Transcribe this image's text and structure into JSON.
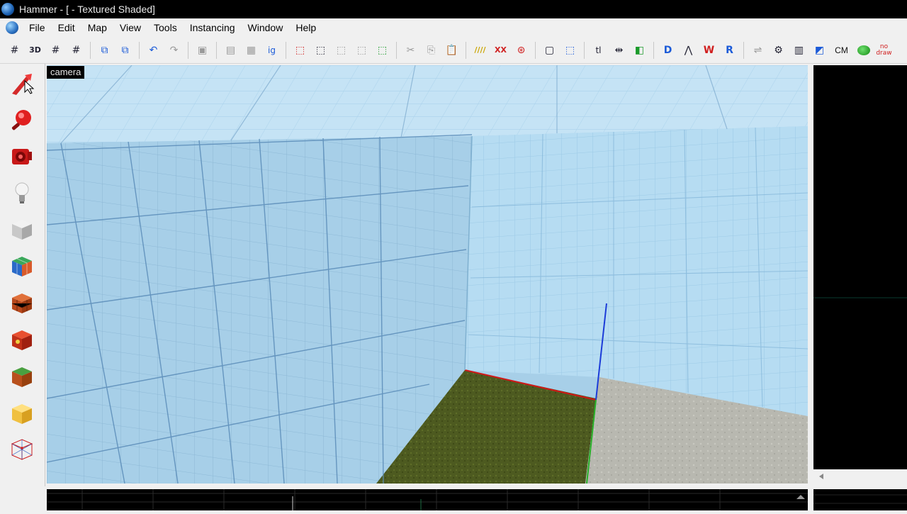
{
  "window": {
    "title": "Hammer - [ - Textured Shaded]"
  },
  "menu": {
    "items": [
      "File",
      "Edit",
      "Map",
      "View",
      "Tools",
      "Instancing",
      "Window",
      "Help"
    ]
  },
  "toolbar": {
    "buttons": [
      {
        "icon": "grid-icon",
        "glyph": "#"
      },
      {
        "icon": "3d-grid-icon",
        "glyph": "3D"
      },
      {
        "icon": "smaller-grid-icon",
        "glyph": "#"
      },
      {
        "icon": "larger-grid-icon",
        "glyph": "#"
      },
      {
        "icon": "group-icon",
        "glyph": "⧉"
      },
      {
        "icon": "ungroup-icon",
        "glyph": "⧉"
      },
      {
        "icon": "undo-icon",
        "glyph": "↶"
      },
      {
        "icon": "redo-icon",
        "glyph": "↷"
      },
      {
        "icon": "carve-icon",
        "glyph": "▣"
      },
      {
        "icon": "hollow-icon",
        "glyph": "▤"
      },
      {
        "icon": "texture-lock-icon",
        "glyph": "▦"
      },
      {
        "icon": "ignore-grouping-icon",
        "glyph": "ig"
      },
      {
        "icon": "selection-box-icon",
        "glyph": "⬚"
      },
      {
        "icon": "select-icon",
        "glyph": "⬚"
      },
      {
        "icon": "copy-icon",
        "glyph": "⬚"
      },
      {
        "icon": "paste-icon",
        "glyph": "⬚"
      },
      {
        "icon": "paste-special-icon",
        "glyph": "⬚"
      },
      {
        "icon": "cut-icon",
        "glyph": "✂"
      },
      {
        "icon": "copy-clip-icon",
        "glyph": "⎘"
      },
      {
        "icon": "paste-clip-icon",
        "glyph": "📋"
      },
      {
        "icon": "hazard-icon",
        "glyph": "////"
      },
      {
        "icon": "hazard-x-icon",
        "glyph": "XX"
      },
      {
        "icon": "run-map-icon",
        "glyph": "⊛"
      },
      {
        "icon": "to-world-icon",
        "glyph": "▢"
      },
      {
        "icon": "to-entity-icon",
        "glyph": "⬚"
      },
      {
        "icon": "align-icon",
        "glyph": "tl"
      },
      {
        "icon": "move-icon",
        "glyph": "⇹"
      },
      {
        "icon": "flip-icon",
        "glyph": "◧"
      },
      {
        "icon": "display-d-icon",
        "glyph": "D"
      },
      {
        "icon": "display-path-icon",
        "glyph": "⋀"
      },
      {
        "icon": "display-w-icon",
        "glyph": "W"
      },
      {
        "icon": "display-r-icon",
        "glyph": "R"
      },
      {
        "icon": "sliders-icon",
        "glyph": "⇌"
      },
      {
        "icon": "gear-icon",
        "glyph": "⚙"
      },
      {
        "icon": "overlay-icon",
        "glyph": "▥"
      },
      {
        "icon": "cubes-icon",
        "glyph": "◩"
      }
    ],
    "cm_label": "CM",
    "nodraw_label_top": "no",
    "nodraw_label_bottom": "draw"
  },
  "tools": [
    {
      "name": "selection-tool",
      "icon": "arrow-pointer-icon"
    },
    {
      "name": "magnify-tool",
      "icon": "magnifier-icon"
    },
    {
      "name": "camera-tool",
      "icon": "camera-icon"
    },
    {
      "name": "entity-tool",
      "icon": "lightbulb-icon"
    },
    {
      "name": "block-tool",
      "icon": "block-icon"
    },
    {
      "name": "texture-application-tool",
      "icon": "texture-cube-icon"
    },
    {
      "name": "apply-current-texture-tool",
      "icon": "apply-texture-icon"
    },
    {
      "name": "decal-tool",
      "icon": "decal-icon"
    },
    {
      "name": "overlay-tool",
      "icon": "overlay-cube-icon"
    },
    {
      "name": "clipping-tool",
      "icon": "clip-icon"
    },
    {
      "name": "vertex-tool",
      "icon": "vertex-icon"
    }
  ],
  "viewport": {
    "label": "camera"
  },
  "colors": {
    "wall": "#a7cfe8",
    "wall_right": "#b6dcf2",
    "ceiling": "#c5e3f5",
    "grass": "#4d5a20",
    "concrete": "#b8b8b0",
    "grid_line": "#5a8cb8"
  }
}
